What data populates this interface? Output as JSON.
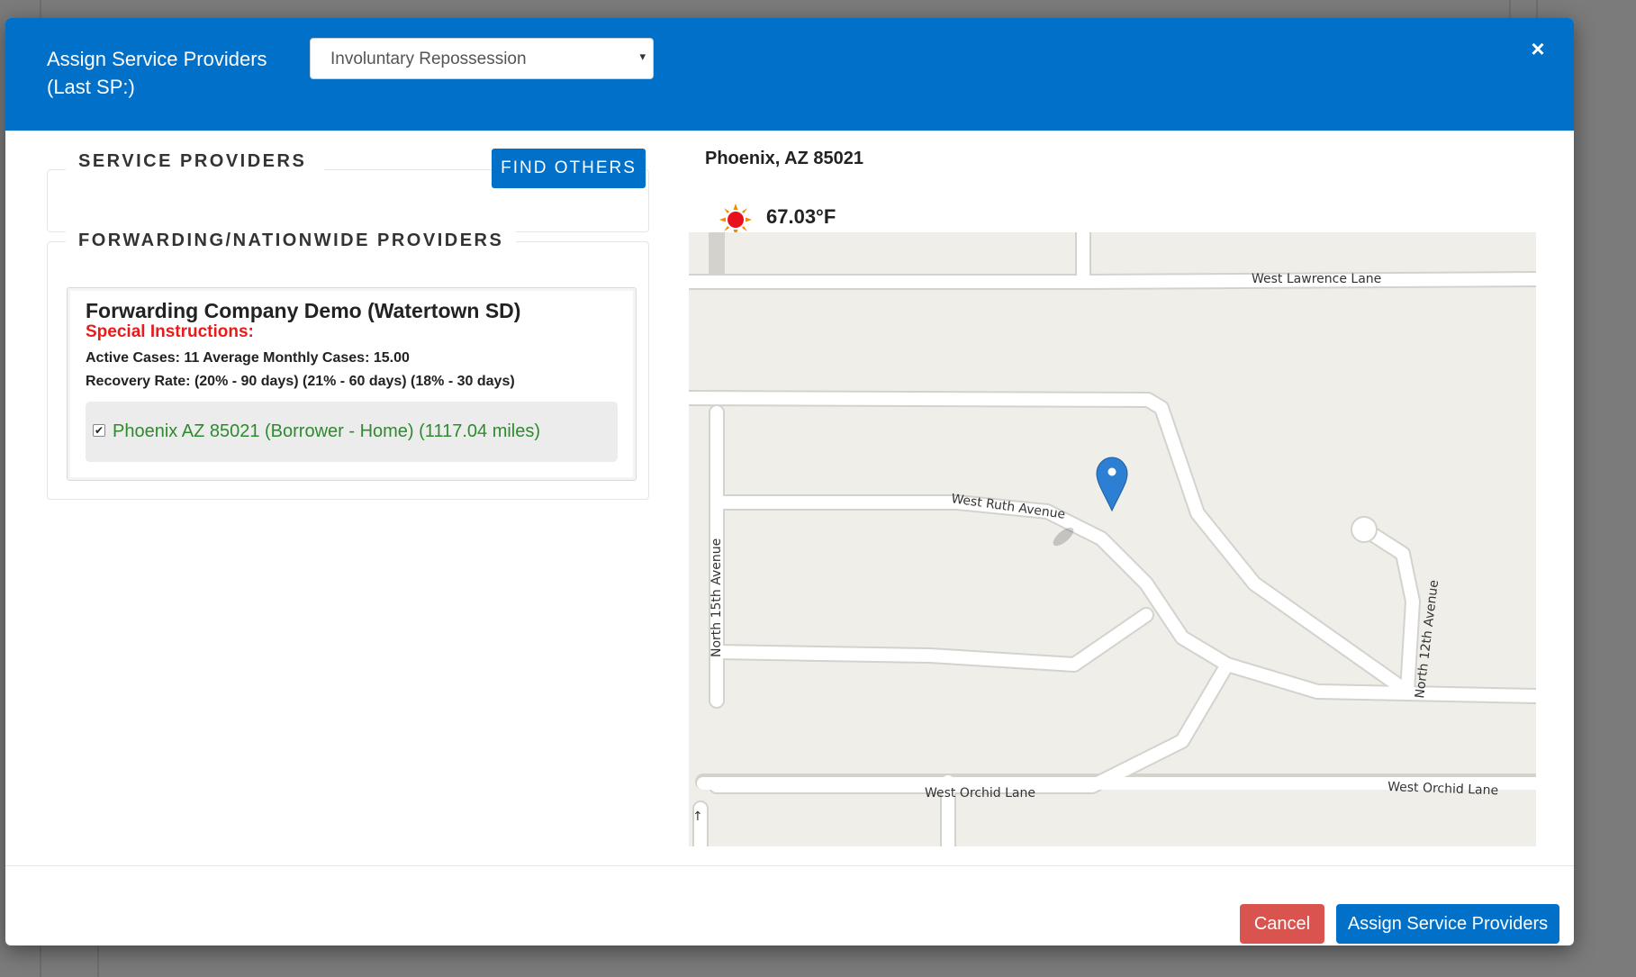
{
  "modal": {
    "title": "Assign Service Providers (Last SP:)",
    "close_label": "×",
    "case_type_select": {
      "selected": "Involuntary Repossession",
      "caret": "▾"
    }
  },
  "service_providers": {
    "heading": "SERVICE PROVIDERS",
    "find_others_label": "FIND OTHERS"
  },
  "forwarding": {
    "heading": "FORWARDING/NATIONWIDE PROVIDERS",
    "provider": {
      "name": "Forwarding Company Demo (Watertown SD)",
      "special_instructions_label": "Special Instructions:",
      "active_cases_line": "Active Cases: 11 Average Monthly Cases: 15.00",
      "recovery_rate_line": "Recovery Rate: (20% - 90 days) (21% - 60 days) (18% - 30 days)",
      "address_checked": true,
      "address_label": "Phoenix AZ 85021 (Borrower - Home) (1117.04 miles)"
    }
  },
  "location": {
    "city_state_zip": "Phoenix, AZ 85021",
    "weather_icon": "sun-icon",
    "temperature": "67.03°F"
  },
  "map": {
    "streets": {
      "west_lawrence_lane": "West Lawrence Lane",
      "west_ruth_avenue": "West Ruth Avenue",
      "north_15th_avenue": "North 15th Avenue",
      "north_12th_avenue": "North 12th Avenue",
      "west_orchid_lane_1": "West Orchid Lane",
      "west_orchid_lane_2": "West Orchid Lane"
    },
    "marker_icon": "map-pin-icon",
    "oneway_arrow": "↑"
  },
  "footer": {
    "cancel_label": "Cancel",
    "assign_label": "Assign Service Providers"
  },
  "colors": {
    "header": "#0170c9",
    "cancel": "#d9534f",
    "special": "#e81b1b",
    "address": "#2e8a2e",
    "map_bg": "#f0eee9",
    "marker": "#2d7fd3"
  }
}
